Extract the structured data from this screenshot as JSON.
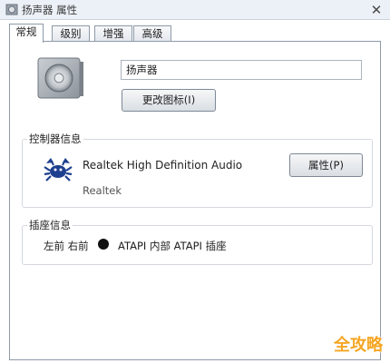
{
  "window": {
    "title": "扬声器 属性",
    "icon": "speaker-icon",
    "close_glyph": "✕"
  },
  "tabs": [
    {
      "label": "常规",
      "active": true
    },
    {
      "label": "级别",
      "active": false
    },
    {
      "label": "增强",
      "active": false
    },
    {
      "label": "高级",
      "active": false
    }
  ],
  "general": {
    "device_name": "扬声器",
    "change_icon_label": "更改图标(I)"
  },
  "controller": {
    "group_label": "控制器信息",
    "name": "Realtek High Definition Audio",
    "vendor": "Realtek",
    "properties_label": "属性(P)",
    "icon": "realtek-crab-icon"
  },
  "jack": {
    "group_label": "插座信息",
    "position": "左前 右前",
    "description": "ATAPI 内部 ATAPI 插座",
    "dot_color": "#111111"
  },
  "watermark": "全攻略"
}
